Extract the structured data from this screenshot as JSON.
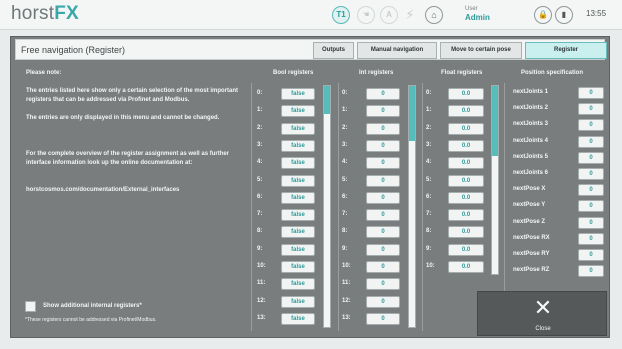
{
  "header": {
    "logo_prefix": "horst",
    "logo_suffix": "FX",
    "mode_t1": "T1",
    "mode_hand": "☚",
    "mode_auto": "A",
    "user_label": "User",
    "user_value": "Admin",
    "time": "13:55"
  },
  "panel": {
    "title": "Free navigation (Register)",
    "tabs": [
      {
        "label": "Outputs",
        "active": false
      },
      {
        "label": "Manual navigation",
        "active": false
      },
      {
        "label": "Move to certain pose",
        "active": false
      },
      {
        "label": "Register",
        "active": true
      }
    ],
    "note": {
      "heading": "Please note:",
      "para1": "The entries listed here show only a certain selection of the most important registers that can be addressed via Profinet and Modbus.",
      "para2": "The entries are only displayed in this menu and cannot be changed.",
      "para3": "For the complete overview of the register assignment as well as further interface information look up the online documentation at:",
      "url": "horstcosmos.com/documentation/External_interfaces"
    },
    "checkbox_label": "Show additional internal registers*",
    "footnote": "*These registers cannot be addressed via Profinet/Modbus.",
    "close_label": "Close"
  },
  "columns": {
    "bool": {
      "header": "Bool registers"
    },
    "int": {
      "header": "Int registers"
    },
    "float": {
      "header": "Float registers"
    },
    "position": {
      "header": "Position specification"
    }
  },
  "bool_registers": [
    {
      "index": "0:",
      "value": "false"
    },
    {
      "index": "1:",
      "value": "false"
    },
    {
      "index": "2:",
      "value": "false"
    },
    {
      "index": "3:",
      "value": "false"
    },
    {
      "index": "4:",
      "value": "false"
    },
    {
      "index": "5:",
      "value": "false"
    },
    {
      "index": "6:",
      "value": "false"
    },
    {
      "index": "7:",
      "value": "false"
    },
    {
      "index": "8:",
      "value": "false"
    },
    {
      "index": "9:",
      "value": "false"
    },
    {
      "index": "10:",
      "value": "false"
    },
    {
      "index": "11:",
      "value": "false"
    },
    {
      "index": "12:",
      "value": "false"
    },
    {
      "index": "13:",
      "value": "false"
    }
  ],
  "int_registers": [
    {
      "index": "0:",
      "value": "0"
    },
    {
      "index": "1:",
      "value": "0"
    },
    {
      "index": "2:",
      "value": "0"
    },
    {
      "index": "3:",
      "value": "0"
    },
    {
      "index": "4:",
      "value": "0"
    },
    {
      "index": "5:",
      "value": "0"
    },
    {
      "index": "6:",
      "value": "0"
    },
    {
      "index": "7:",
      "value": "0"
    },
    {
      "index": "8:",
      "value": "0"
    },
    {
      "index": "9:",
      "value": "0"
    },
    {
      "index": "10:",
      "value": "0"
    },
    {
      "index": "11:",
      "value": "0"
    },
    {
      "index": "12:",
      "value": "0"
    },
    {
      "index": "13:",
      "value": "0"
    }
  ],
  "float_registers": [
    {
      "index": "0:",
      "value": "0.0"
    },
    {
      "index": "1:",
      "value": "0.0"
    },
    {
      "index": "2:",
      "value": "0.0"
    },
    {
      "index": "3:",
      "value": "0.0"
    },
    {
      "index": "4:",
      "value": "0.0"
    },
    {
      "index": "5:",
      "value": "0.0"
    },
    {
      "index": "6:",
      "value": "0.0"
    },
    {
      "index": "7:",
      "value": "0.0"
    },
    {
      "index": "8:",
      "value": "0.0"
    },
    {
      "index": "9:",
      "value": "0.0"
    },
    {
      "index": "10:",
      "value": "0.0"
    }
  ],
  "position_spec": [
    {
      "label": "nextJoints 1",
      "value": "0"
    },
    {
      "label": "nextJoints 2",
      "value": "0"
    },
    {
      "label": "nextJoints 3",
      "value": "0"
    },
    {
      "label": "nextJoints 4",
      "value": "0"
    },
    {
      "label": "nextJoints 5",
      "value": "0"
    },
    {
      "label": "nextJoints 6",
      "value": "0"
    },
    {
      "label": "nextPose X",
      "value": "0"
    },
    {
      "label": "nextPose Y",
      "value": "0"
    },
    {
      "label": "nextPose Z",
      "value": "0"
    },
    {
      "label": "nextPose RX",
      "value": "0"
    },
    {
      "label": "nextPose RY",
      "value": "0"
    },
    {
      "label": "nextPose RZ",
      "value": "0"
    }
  ],
  "colors": {
    "accent": "#3aa8a8",
    "panel_bg": "#7a7d7d",
    "active_tab": "#c9efef"
  }
}
